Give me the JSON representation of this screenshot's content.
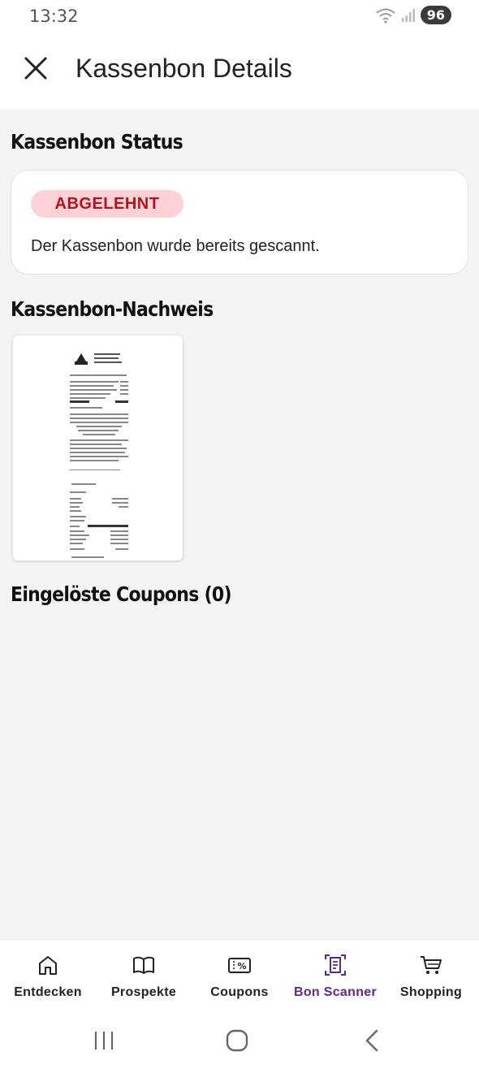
{
  "status_bar": {
    "time": "13:32",
    "battery": "96"
  },
  "header": {
    "title": "Kassenbon Details"
  },
  "status_section": {
    "title": "Kassenbon Status",
    "badge": "ABGELEHNT",
    "message": "Der Kassenbon wurde bereits gescannt."
  },
  "proof_section": {
    "title": "Kassenbon-Nachweis"
  },
  "coupons_section": {
    "title": "Eingelöste Coupons (0)"
  },
  "bottom_nav": {
    "items": [
      {
        "label": "Entdecken",
        "icon": "home-icon"
      },
      {
        "label": "Prospekte",
        "icon": "book-icon"
      },
      {
        "label": "Coupons",
        "icon": "coupon-icon"
      },
      {
        "label": "Bon Scanner",
        "icon": "receipt-scanner-icon",
        "active": true
      },
      {
        "label": "Shopping",
        "icon": "cart-icon"
      }
    ]
  },
  "colors": {
    "accent": "#5b2a86",
    "badge_bg": "#fcd2d7",
    "badge_text": "#b3121f"
  }
}
